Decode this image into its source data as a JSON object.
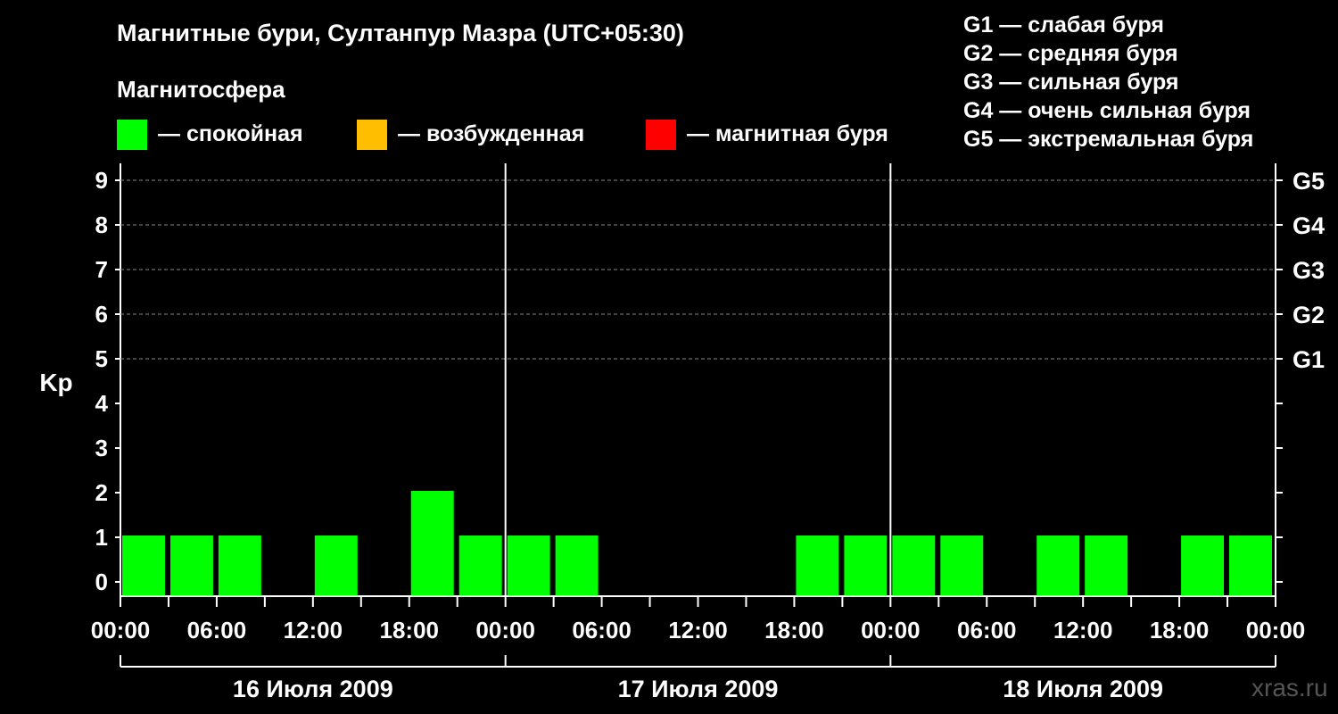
{
  "title": "Магнитные бури, Султанпур Мазра (UTC+05:30)",
  "subtitle": "Магнитосфера",
  "legend": [
    {
      "label": "— спокойная",
      "color": "#00ff00"
    },
    {
      "label": "— возбужденная",
      "color": "#ffbf00"
    },
    {
      "label": "— магнитная буря",
      "color": "#ff0000"
    }
  ],
  "g_scale": [
    "G1 — слабая буря",
    "G2 — средняя буря",
    "G3 — сильная буря",
    "G4 — очень сильная буря",
    "G5 — экстремальная буря"
  ],
  "watermark": "xras.ru",
  "chart_data": {
    "type": "bar",
    "ylabel": "Kp",
    "ylim": [
      0,
      9
    ],
    "yticks": [
      "0",
      "1",
      "2",
      "3",
      "4",
      "5",
      "6",
      "7",
      "8",
      "9"
    ],
    "g_levels": [
      {
        "label": "G1",
        "kp": 5
      },
      {
        "label": "G2",
        "kp": 6
      },
      {
        "label": "G3",
        "kp": 7
      },
      {
        "label": "G4",
        "kp": 8
      },
      {
        "label": "G5",
        "kp": 9
      }
    ],
    "x_tick_labels": [
      "00:00",
      "06:00",
      "12:00",
      "18:00",
      "00:00",
      "06:00",
      "12:00",
      "18:00",
      "00:00",
      "06:00",
      "12:00",
      "18:00",
      "00:00"
    ],
    "days": [
      "16 Июля 2009",
      "17 Июля 2009",
      "18 Июля 2009"
    ],
    "interval_hours": 3,
    "values": [
      1,
      1,
      1,
      0,
      1,
      0,
      2,
      1,
      1,
      1,
      0,
      0,
      0,
      0,
      1,
      1,
      1,
      1,
      0,
      1,
      1,
      0,
      1,
      1
    ],
    "colors": {
      "quiet": "#00ff00",
      "active": "#ffbf00",
      "storm": "#ff0000"
    },
    "grid": true
  }
}
